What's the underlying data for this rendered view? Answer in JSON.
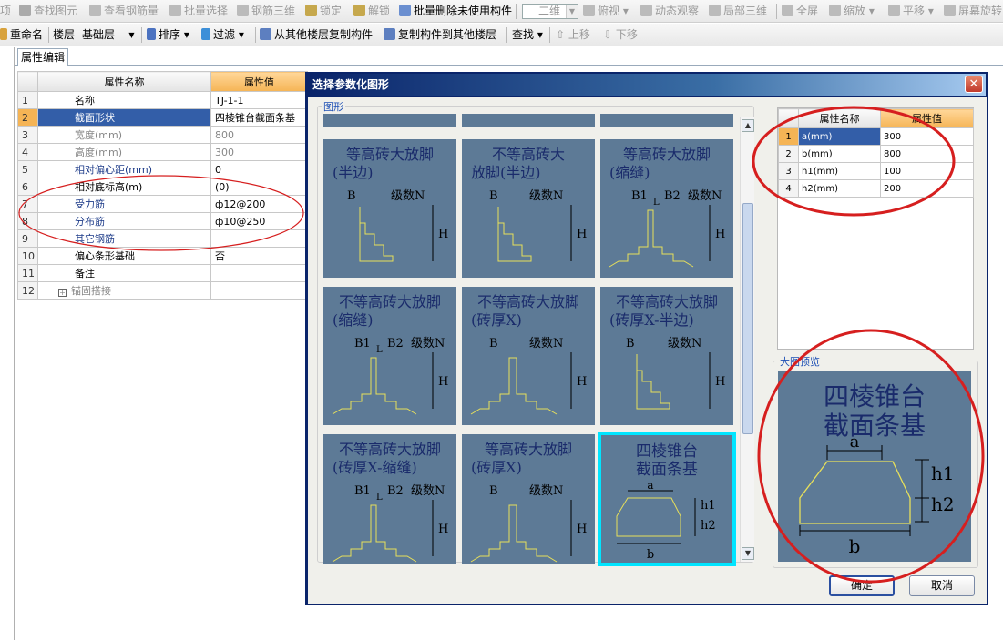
{
  "toolbar1": {
    "items": [
      "查找图元",
      "查看钢筋量",
      "批量选择",
      "钢筋三维",
      "锁定",
      "解锁",
      "批量删除未使用构件",
      "二维",
      "俯视",
      "动态观察",
      "局部三维",
      "全屏",
      "缩放",
      "平移",
      "屏幕旋转"
    ],
    "first_fragment": "项"
  },
  "toolbar2": {
    "rename": "重命名",
    "floor_label": "楼层",
    "floor_value": "基础层",
    "sort": "排序",
    "filter": "过滤",
    "copy_from": "从其他楼层复制构件",
    "copy_to": "复制构件到其他楼层",
    "find": "查找",
    "up": "上移",
    "down": "下移"
  },
  "tab": "属性编辑",
  "prop_grid": {
    "col_name": "属性名称",
    "col_value": "属性值",
    "rows": [
      {
        "n": "1",
        "name": "名称",
        "value": "TJ-1-1",
        "style": "normal"
      },
      {
        "n": "2",
        "name": "截面形状",
        "value": "四棱锥台截面条基",
        "style": "selected"
      },
      {
        "n": "3",
        "name": "宽度(mm)",
        "value": "800",
        "style": "gray"
      },
      {
        "n": "4",
        "name": "高度(mm)",
        "value": "300",
        "style": "gray"
      },
      {
        "n": "5",
        "name": "相对偏心距(mm)",
        "value": "0",
        "style": "blue"
      },
      {
        "n": "6",
        "name": "相对底标高(m)",
        "value": "(0)",
        "style": "normal"
      },
      {
        "n": "7",
        "name": "受力筋",
        "value": "ф12@200",
        "style": "blue"
      },
      {
        "n": "8",
        "name": "分布筋",
        "value": "ф10@250",
        "style": "blue"
      },
      {
        "n": "9",
        "name": "其它钢筋",
        "value": "",
        "style": "blue"
      },
      {
        "n": "10",
        "name": "偏心条形基础",
        "value": "否",
        "style": "normal"
      },
      {
        "n": "11",
        "name": "备注",
        "value": "",
        "style": "normal"
      },
      {
        "n": "12",
        "name": "锚固搭接",
        "value": "",
        "style": "gray"
      }
    ]
  },
  "dialog": {
    "title": "选择参数化图形",
    "group_label": "图形",
    "shapes": [
      {
        "line1": "等高砖大放脚",
        "line2": "(半边)",
        "labels": {
          "b": "B",
          "n": "级数N",
          "h": "H"
        }
      },
      {
        "line1": "不等高砖大",
        "line2": "放脚(半边)",
        "labels": {
          "b": "B",
          "n": "级数N",
          "h": "H"
        }
      },
      {
        "line1": "等高砖大放脚",
        "line2": "(缩缝)",
        "labels": {
          "b1": "B1",
          "l": "L",
          "b2": "B2",
          "n": "级数N",
          "h": "H"
        }
      },
      {
        "line1": "不等高砖大放脚",
        "line2": "(缩缝)",
        "labels": {
          "b1": "B1",
          "l": "L",
          "b2": "B2",
          "n": "级数N",
          "h": "H"
        }
      },
      {
        "line1": "不等高砖大放脚",
        "line2": "(砖厚X)",
        "labels": {
          "b": "B",
          "n": "级数N",
          "h": "H"
        }
      },
      {
        "line1": "不等高砖大放脚",
        "line2": "(砖厚X-半边)",
        "labels": {
          "b": "B",
          "n": "级数N",
          "h": "H"
        }
      },
      {
        "line1": "不等高砖大放脚",
        "line2": "(砖厚X-缩缝)",
        "labels": {
          "b1": "B1",
          "l": "L",
          "b2": "B2",
          "n": "级数N",
          "h": "H"
        }
      },
      {
        "line1": "等高砖大放脚",
        "line2": "(砖厚X)",
        "labels": {
          "b": "B",
          "n": "级数N",
          "h": "H"
        }
      },
      {
        "line1": "四棱锥台",
        "line2": "截面条基",
        "labels": {
          "a": "a",
          "b": "b",
          "h1": "h1",
          "h2": "h2"
        }
      }
    ],
    "param_grid": {
      "col_name": "属性名称",
      "col_value": "属性值",
      "rows": [
        {
          "n": "1",
          "name": "a(mm)",
          "value": "300"
        },
        {
          "n": "2",
          "name": "b(mm)",
          "value": "800"
        },
        {
          "n": "3",
          "name": "h1(mm)",
          "value": "100"
        },
        {
          "n": "4",
          "name": "h2(mm)",
          "value": "200"
        }
      ]
    },
    "preview_label": "大图预览",
    "preview": {
      "line1": "四棱锥台",
      "line2": "截面条基",
      "a": "a",
      "b": "b",
      "h1": "h1",
      "h2": "h2"
    },
    "ok": "确定",
    "cancel": "取消"
  }
}
